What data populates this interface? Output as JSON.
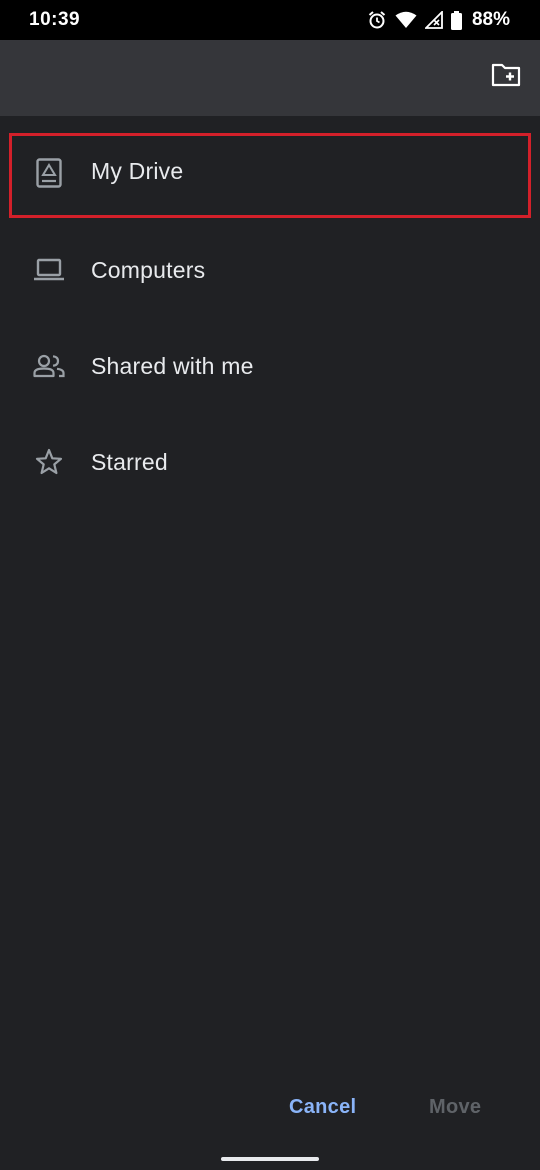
{
  "status_bar": {
    "time": "10:39",
    "battery_percent": "88%",
    "icons": [
      "alarm-icon",
      "wifi-icon",
      "signal-icon",
      "battery-icon"
    ]
  },
  "toolbar": {
    "new_folder_icon": "create-folder-icon"
  },
  "locations": [
    {
      "label": "My Drive",
      "icon": "drive-icon",
      "highlighted": true
    },
    {
      "label": "Computers",
      "icon": "laptop-icon"
    },
    {
      "label": "Shared with me",
      "icon": "people-icon"
    },
    {
      "label": "Starred",
      "icon": "star-icon"
    }
  ],
  "footer": {
    "cancel_label": "Cancel",
    "move_label": "Move"
  },
  "colors": {
    "background": "#202124",
    "toolbar": "#35363a",
    "accent": "#8ab4f8",
    "disabled": "#5f6368",
    "highlight_border": "#d3202a"
  }
}
